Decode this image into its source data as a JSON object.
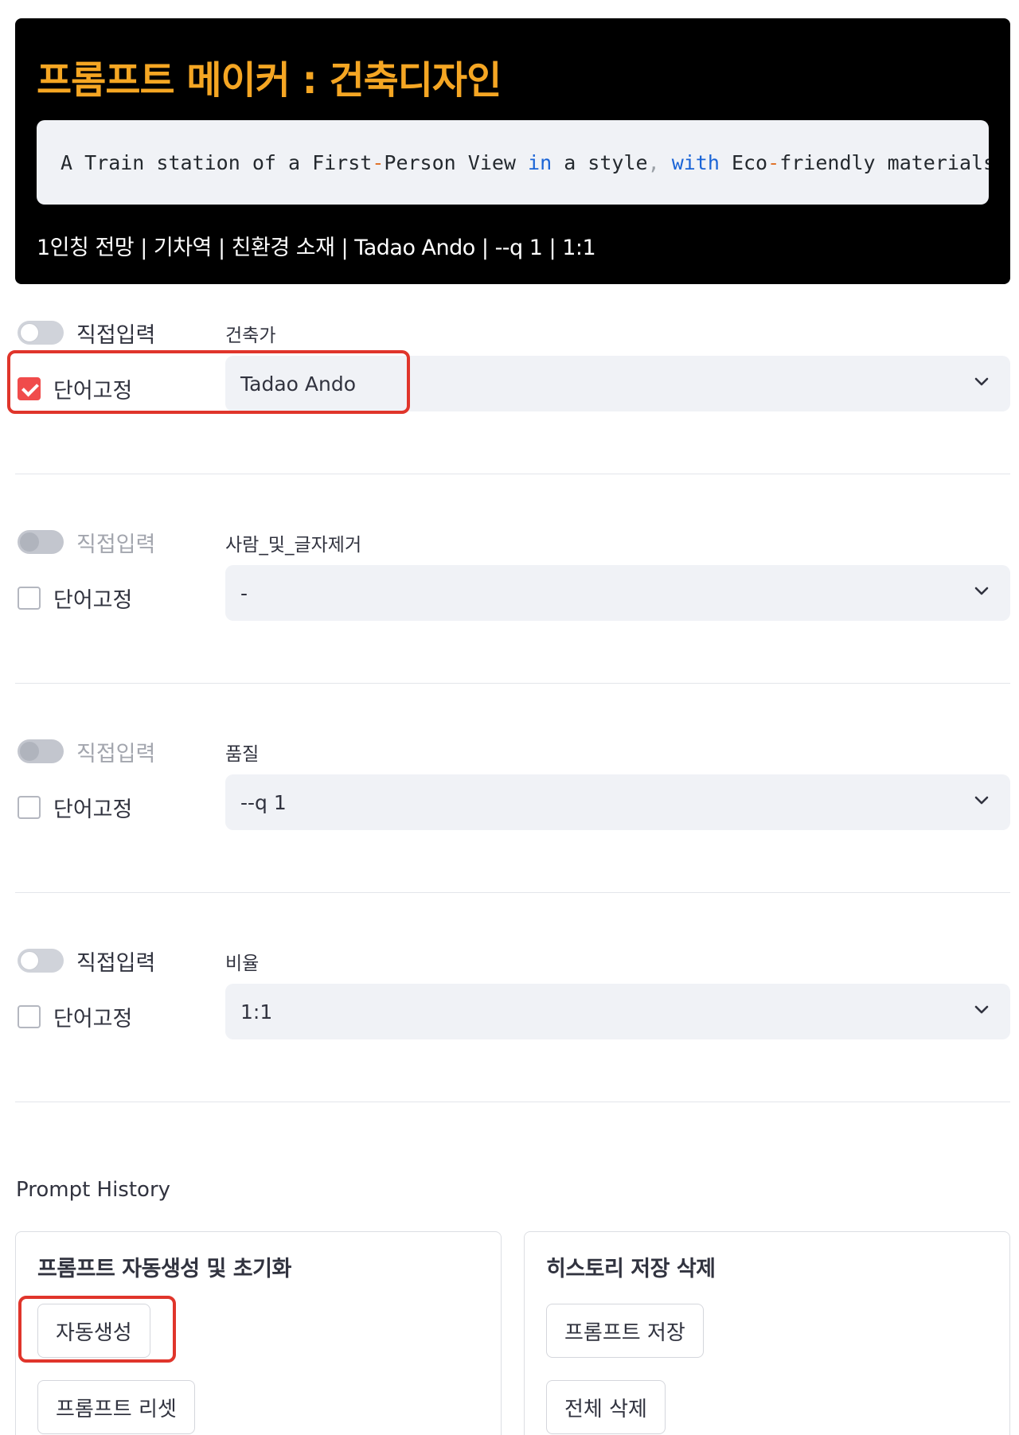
{
  "header": {
    "title": "프롬프트 메이커 : 건축디자인",
    "prompt_tokens": [
      {
        "t": "A Train station of a First",
        "c": ""
      },
      {
        "t": "-",
        "c": "op"
      },
      {
        "t": "Person View ",
        "c": ""
      },
      {
        "t": "in",
        "c": "kw"
      },
      {
        "t": " a  style",
        "c": ""
      },
      {
        "t": ",",
        "c": "punct"
      },
      {
        "t": " ",
        "c": ""
      },
      {
        "t": "with",
        "c": "kw"
      },
      {
        "t": " Eco",
        "c": ""
      },
      {
        "t": "-",
        "c": "op"
      },
      {
        "t": "friendly materials",
        "c": ""
      }
    ],
    "summary": "1인칭 전망 | 기차역 | 친환경 소재 | Tadao Ando | --q 1 | 1:1"
  },
  "rows": [
    {
      "toggle_label": "직접입력",
      "toggle_disabled": false,
      "check_label": "단어고정",
      "checked": true,
      "field_label": "건축가",
      "value": "Tadao Ando"
    },
    {
      "toggle_label": "직접입력",
      "toggle_disabled": true,
      "check_label": "단어고정",
      "checked": false,
      "field_label": "사람_및_글자제거",
      "value": "-"
    },
    {
      "toggle_label": "직접입력",
      "toggle_disabled": true,
      "check_label": "단어고정",
      "checked": false,
      "field_label": "품질",
      "value": "--q 1"
    },
    {
      "toggle_label": "직접입력",
      "toggle_disabled": false,
      "check_label": "단어고정",
      "checked": false,
      "field_label": "비율",
      "value": "1:1"
    }
  ],
  "history": {
    "title": "Prompt History",
    "left_card": {
      "title": "프롬프트 자동생성 및 초기화",
      "btn1": "자동생성",
      "btn2": "프롬프트 리셋"
    },
    "right_card": {
      "title": "히스토리 저장 삭제",
      "btn1": "프롬프트 저장",
      "btn2": "전체 삭제"
    }
  },
  "colors": {
    "accent": "#f5a623",
    "highlight": "#e0352b",
    "check": "#f04b4b"
  }
}
